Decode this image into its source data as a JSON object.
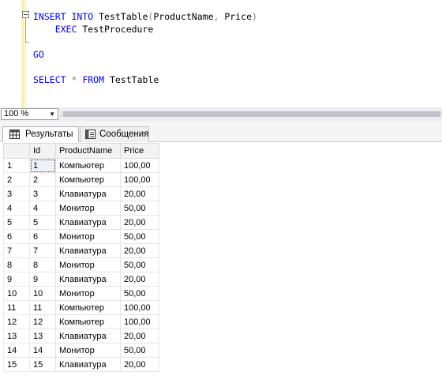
{
  "editor": {
    "lines": [
      {
        "tokens": [
          {
            "t": "INSERT INTO ",
            "c": "kw"
          },
          {
            "t": "TestTable",
            "c": ""
          },
          {
            "t": "(",
            "c": "op"
          },
          {
            "t": "ProductName",
            "c": ""
          },
          {
            "t": ", ",
            "c": "op"
          },
          {
            "t": "Price",
            "c": ""
          },
          {
            "t": ")",
            "c": "op"
          }
        ]
      },
      {
        "tokens": [
          {
            "t": "    EXEC ",
            "c": "kw"
          },
          {
            "t": "TestProcedure",
            "c": ""
          }
        ]
      },
      {
        "tokens": []
      },
      {
        "tokens": [
          {
            "t": "GO",
            "c": "kw"
          }
        ]
      },
      {
        "tokens": []
      },
      {
        "tokens": [
          {
            "t": "SELECT ",
            "c": "kw"
          },
          {
            "t": "* ",
            "c": "op"
          },
          {
            "t": "FROM ",
            "c": "kw"
          },
          {
            "t": "TestTable",
            "c": ""
          }
        ]
      }
    ]
  },
  "zoom": {
    "value": "100 %"
  },
  "tabs": {
    "results": "Результаты",
    "messages": "Сообщения"
  },
  "grid": {
    "columns": [
      "Id",
      "ProductName",
      "Price"
    ],
    "rows": [
      [
        "1",
        "1",
        "Компьютер",
        "100,00"
      ],
      [
        "2",
        "2",
        "Компьютер",
        "100,00"
      ],
      [
        "3",
        "3",
        "Клавиатура",
        "20,00"
      ],
      [
        "4",
        "4",
        "Монитор",
        "50,00"
      ],
      [
        "5",
        "5",
        "Клавиатура",
        "20,00"
      ],
      [
        "6",
        "6",
        "Монитор",
        "50,00"
      ],
      [
        "7",
        "7",
        "Клавиатура",
        "20,00"
      ],
      [
        "8",
        "8",
        "Монитор",
        "50,00"
      ],
      [
        "9",
        "9",
        "Клавиатура",
        "20,00"
      ],
      [
        "10",
        "10",
        "Монитор",
        "50,00"
      ],
      [
        "11",
        "11",
        "Компьютер",
        "100,00"
      ],
      [
        "12",
        "12",
        "Компьютер",
        "100,00"
      ],
      [
        "13",
        "13",
        "Клавиатура",
        "20,00"
      ],
      [
        "14",
        "14",
        "Монитор",
        "50,00"
      ],
      [
        "15",
        "15",
        "Клавиатура",
        "20,00"
      ]
    ]
  },
  "colors": {
    "keyword": "#0000ff",
    "operator": "#808080",
    "margin": "#fff29e"
  }
}
